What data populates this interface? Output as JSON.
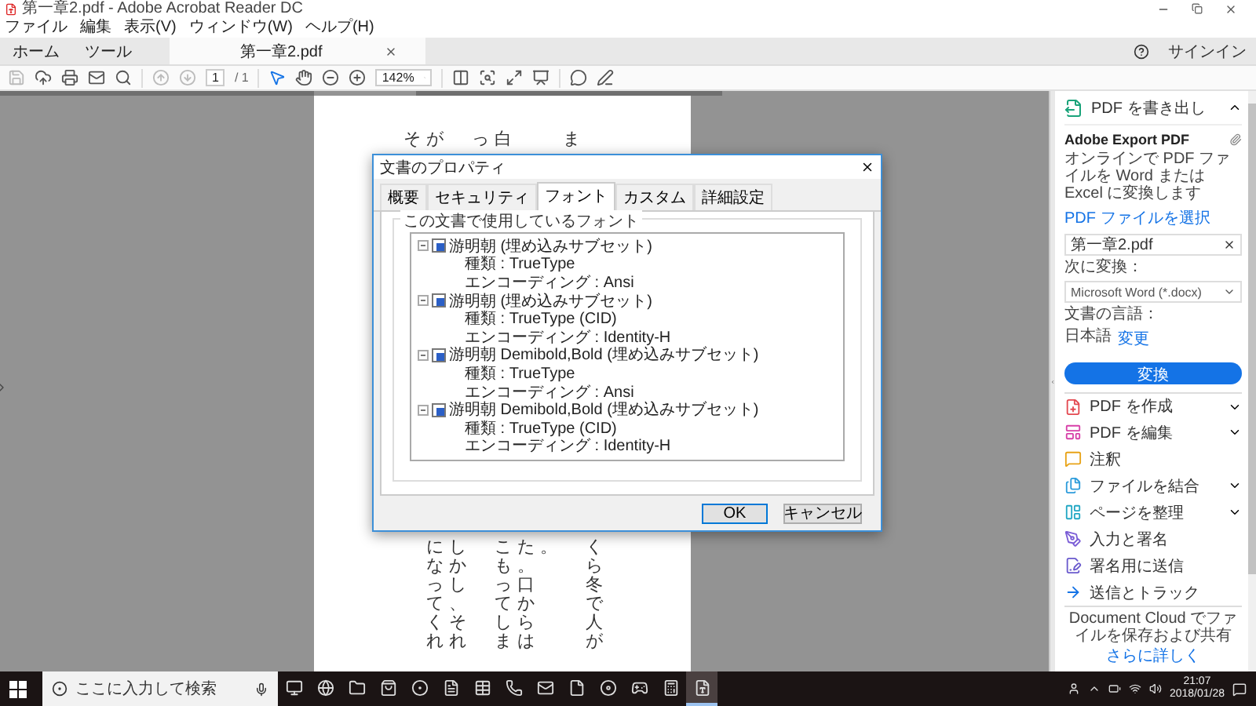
{
  "window": {
    "title": "第一章2.pdf - Adobe Acrobat Reader DC"
  },
  "menu": [
    "ファイル",
    "編集",
    "表示(V)",
    "ウィンドウ(W)",
    "ヘルプ(H)"
  ],
  "nav_tabs": [
    {
      "label": "ホーム",
      "selected": false
    },
    {
      "label": "ツール",
      "selected": false
    },
    {
      "label": "第一章2.pdf",
      "selected": true
    }
  ],
  "signin": "サインイン",
  "toolbar": {
    "tools": [
      {
        "kind": "save",
        "disabled": true,
        "selected": false
      },
      {
        "kind": "upload",
        "disabled": false,
        "selected": false
      },
      {
        "kind": "print",
        "disabled": false,
        "selected": false
      },
      {
        "kind": "mail",
        "disabled": false,
        "selected": false
      },
      {
        "kind": "search",
        "disabled": false,
        "selected": false
      },
      {
        "kind": "prev",
        "disabled": true,
        "selected": false
      },
      {
        "kind": "next",
        "disabled": true,
        "selected": false
      },
      {
        "kind": "page",
        "disabled": false,
        "selected": false
      },
      {
        "kind": "select",
        "disabled": false,
        "selected": true
      },
      {
        "kind": "hand",
        "disabled": false,
        "selected": false
      },
      {
        "kind": "zoomout",
        "disabled": false,
        "selected": false
      },
      {
        "kind": "zoomin",
        "disabled": false,
        "selected": false
      },
      {
        "kind": "zoom",
        "disabled": false,
        "selected": false
      },
      {
        "kind": "fitpage",
        "disabled": false,
        "selected": false
      },
      {
        "kind": "fitwidth",
        "disabled": false,
        "selected": false
      },
      {
        "kind": "fullscreen",
        "disabled": false,
        "selected": false
      },
      {
        "kind": "read",
        "disabled": false,
        "selected": false
      },
      {
        "kind": "comment",
        "disabled": false,
        "selected": false
      },
      {
        "kind": "draw",
        "disabled": false,
        "selected": false
      }
    ],
    "page": "1",
    "page_total": "/ 1",
    "zoom": "142%"
  },
  "page": {
    "columns": [
      {
        "top": "そ"
      },
      {
        "top": "が",
        "bottom": "になってくれ"
      },
      {
        "bottom": "しかし、それ"
      },
      {
        "top": "っ"
      },
      {
        "top": "白",
        "bottom": "こもってしま"
      },
      {
        "bottom": "た。口からは"
      },
      {
        "bottom": "。"
      },
      {
        "top": "ま"
      },
      {
        "bottom": "くら冬で人が"
      }
    ]
  },
  "dialog": {
    "title": "文書のプロパティ",
    "tabs": [
      {
        "label": "概要",
        "selected": false
      },
      {
        "label": "セキュリティ",
        "selected": false
      },
      {
        "label": "フォント",
        "selected": true
      },
      {
        "label": "カスタム",
        "selected": false
      },
      {
        "label": "詳細設定",
        "selected": false
      }
    ],
    "group_label": "この文書で使用しているフォント",
    "fonts": [
      {
        "name": "游明朝 (埋め込みサブセット)",
        "expanded": true,
        "children": [
          "種類 : TrueType",
          "エンコーディング : Ansi"
        ]
      },
      {
        "name": "游明朝 (埋め込みサブセット)",
        "expanded": true,
        "children": [
          "種類 : TrueType (CID)",
          "エンコーディング : Identity-H"
        ]
      },
      {
        "name": "游明朝 Demibold,Bold (埋め込みサブセット)",
        "expanded": true,
        "children": [
          "種類 : TrueType",
          "エンコーディング : Ansi"
        ]
      },
      {
        "name": "游明朝 Demibold,Bold (埋め込みサブセット)",
        "expanded": true,
        "children": [
          "種類 : TrueType (CID)",
          "エンコーディング : Identity-H"
        ]
      }
    ],
    "buttons": [
      {
        "label": "OK",
        "default": true
      },
      {
        "label": "キャンセル",
        "default": false
      }
    ]
  },
  "panel": {
    "export": {
      "title": "PDF を書き出し",
      "expanded": true,
      "service": "Adobe Export PDF",
      "description": "オンラインで PDF ファイルを Word または Excel に変換します",
      "select_link": "PDF ファイルを選択",
      "file": "第一章2.pdf",
      "convert_label": "次に変換：",
      "format": "Microsoft Word (*.docx)",
      "language_label": "文書の言語：",
      "language": "日本語",
      "change_link": "変更",
      "button": "変換"
    },
    "tools": [
      {
        "kind": "create",
        "label": "PDF を作成",
        "expandable": true
      },
      {
        "kind": "edit",
        "label": "PDF を編集",
        "expandable": true
      },
      {
        "kind": "comment",
        "label": "注釈",
        "expandable": false
      },
      {
        "kind": "combine",
        "label": "ファイルを結合",
        "expandable": true
      },
      {
        "kind": "organize",
        "label": "ページを整理",
        "expandable": true
      },
      {
        "kind": "fill",
        "label": "入力と署名",
        "expandable": false
      },
      {
        "kind": "sign",
        "label": "署名用に送信",
        "expandable": false
      },
      {
        "kind": "send",
        "label": "送信とトラック",
        "expandable": false
      }
    ],
    "footer": {
      "text": "Document Cloud でファイルを保存および共有",
      "link": "さらに詳しく"
    }
  },
  "taskbar": {
    "search_placeholder": "ここに入力して検索",
    "apps": [
      {
        "kind": "taskview",
        "selected": false
      },
      {
        "kind": "browser",
        "selected": false
      },
      {
        "kind": "folder",
        "selected": false
      },
      {
        "kind": "store",
        "selected": false
      },
      {
        "kind": "chrome",
        "selected": false
      },
      {
        "kind": "word",
        "selected": false
      },
      {
        "kind": "excel",
        "selected": false
      },
      {
        "kind": "chat",
        "selected": false
      },
      {
        "kind": "mail",
        "selected": false
      },
      {
        "kind": "file",
        "selected": false
      },
      {
        "kind": "disc",
        "selected": false
      },
      {
        "kind": "game",
        "selected": false
      },
      {
        "kind": "calculator",
        "selected": false
      },
      {
        "kind": "acrobat",
        "selected": true
      }
    ],
    "time": "21:07",
    "date": "2018/01/28"
  }
}
